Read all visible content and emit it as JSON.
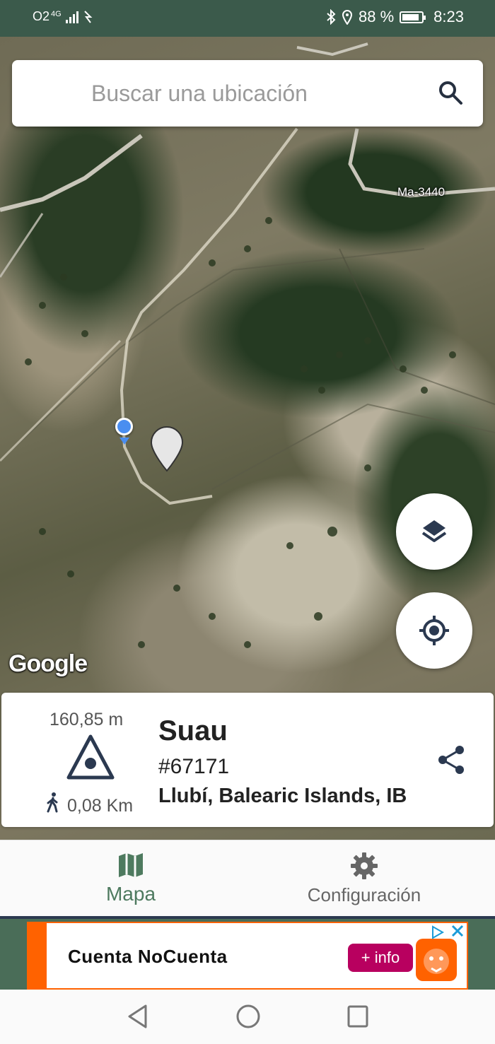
{
  "status_bar": {
    "carrier": "O2",
    "network": "4G",
    "battery_text": "88 %",
    "battery_level_percent": 88,
    "time": "8:23"
  },
  "search": {
    "placeholder": "Buscar una ubicación",
    "icon": "search-icon"
  },
  "map": {
    "road_label": "Ma-3440",
    "attribution": "Google",
    "layers_button_icon": "layers-icon",
    "locate_button_icon": "my-location-icon"
  },
  "info_card": {
    "elevation": "160,85 m",
    "distance": "0,08 Km",
    "name": "Suau",
    "code": "#67171",
    "location": "Llubí, Balearic Islands, IB",
    "share_icon": "share-icon"
  },
  "bottom_nav": {
    "items": [
      {
        "label": "Mapa",
        "icon": "map-icon",
        "active": true
      },
      {
        "label": "Configuración",
        "icon": "gear-icon",
        "active": false
      }
    ]
  },
  "ad": {
    "title": "Cuenta NoCuenta",
    "button_label": "+ info",
    "brand_color": "#ff6200"
  },
  "colors": {
    "accent": "#4e7a5f",
    "status_bar": "#3b5a4b",
    "gps_dot": "#4a8ef0",
    "icon_dark": "#2b3950"
  }
}
